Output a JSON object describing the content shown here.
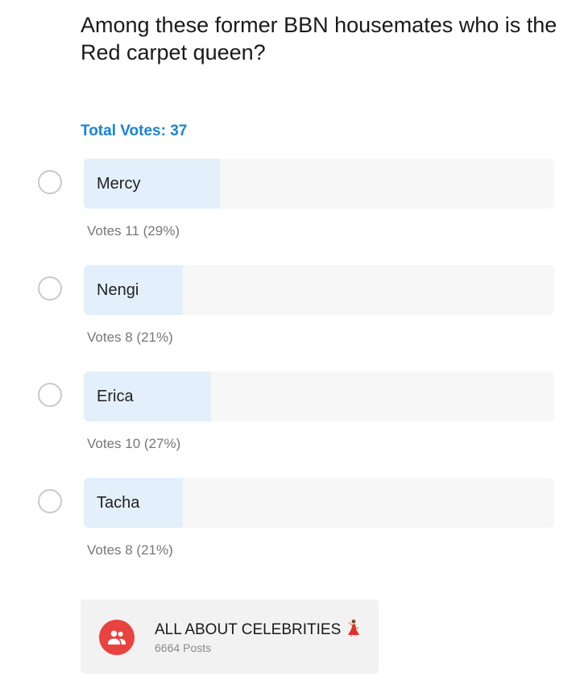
{
  "poll": {
    "question": "Among these former BBN housemates who is the Red carpet queen?",
    "total_votes_label": "Total Votes: 37",
    "options": [
      {
        "label": "Mercy",
        "votes_text": "Votes 11 (29%)",
        "percent": 29
      },
      {
        "label": "Nengi",
        "votes_text": "Votes 8 (21%)",
        "percent": 21
      },
      {
        "label": "Erica",
        "votes_text": "Votes 10 (27%)",
        "percent": 27
      },
      {
        "label": "Tacha",
        "votes_text": "Votes 8 (21%)",
        "percent": 21
      }
    ]
  },
  "group": {
    "name": "ALL ABOUT CELEBRITIES",
    "emoji_icon": "dancing-woman-icon",
    "posts_count": "6664",
    "posts_label": "Posts",
    "avatar_icon": "group-people-icon",
    "avatar_color": "#e8433f"
  },
  "colors": {
    "accent": "#1a83d6",
    "bar_fill": "#e3f0fb",
    "bar_track": "#f7f7f7"
  }
}
